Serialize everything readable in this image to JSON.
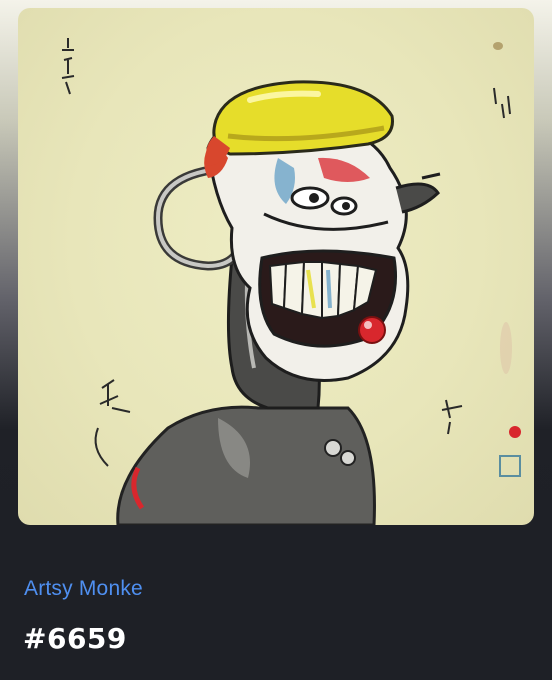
{
  "nft": {
    "image_alt": "Artsy Monke #6659",
    "collection": "Artsy Monke",
    "token_id": "#6659"
  },
  "colors": {
    "collection_link": "#4f8ff0",
    "title": "#ffffff",
    "card_background": "#1e2026",
    "art_background": "#e8e6ba",
    "hat_yellow": "#e6dd2a",
    "nose_red": "#d8272d"
  }
}
